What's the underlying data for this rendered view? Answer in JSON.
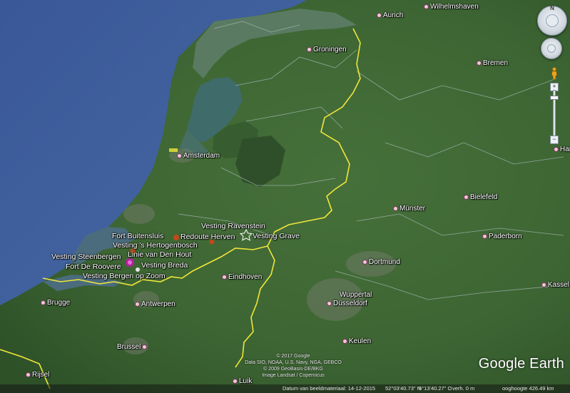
{
  "map": {
    "cities": [
      {
        "id": "aurich",
        "label": "Aurich"
      },
      {
        "id": "wilhelmshaven",
        "label": "Wilhelmshaven"
      },
      {
        "id": "groningen",
        "label": "Groningen"
      },
      {
        "id": "bremen",
        "label": "Bremen"
      },
      {
        "id": "amsterdam",
        "label": "Amsterdam"
      },
      {
        "id": "ham",
        "label": "Ham"
      },
      {
        "id": "bielefeld",
        "label": "Bielefeld"
      },
      {
        "id": "munster",
        "label": "Münster"
      },
      {
        "id": "paderborn",
        "label": "Paderborn"
      },
      {
        "id": "dortmund",
        "label": "Dortmund"
      },
      {
        "id": "eindhoven",
        "label": "Eindhoven"
      },
      {
        "id": "wuppertal",
        "label": "Wuppertal"
      },
      {
        "id": "dusseldorf",
        "label": "Düsseldorf"
      },
      {
        "id": "kassel",
        "label": "Kassel"
      },
      {
        "id": "brugge",
        "label": "Brugge"
      },
      {
        "id": "antwerpen",
        "label": "Antwerpen"
      },
      {
        "id": "keulen",
        "label": "Keulen"
      },
      {
        "id": "brussel",
        "label": "Brussel"
      },
      {
        "id": "rijsel",
        "label": "Rijsel"
      },
      {
        "id": "luik",
        "label": "Luik"
      }
    ],
    "places": [
      {
        "id": "vesting-ravenstein",
        "label": "Vesting Ravenstein"
      },
      {
        "id": "redoute-herven",
        "label": "Redoute Herven"
      },
      {
        "id": "vesting-grave",
        "label": "Vesting Grave"
      },
      {
        "id": "fort-buitensluis",
        "label": "Fort Buitensluis"
      },
      {
        "id": "vesting-hertogenbosch",
        "label": "Vesting 's Hertogenbosch"
      },
      {
        "id": "vesting-steenbergen",
        "label": "Vesting Steenbergen"
      },
      {
        "id": "linie-van-den-hout",
        "label": "Linie van Den Hout"
      },
      {
        "id": "fort-de-roovere",
        "label": "Fort De Roovere"
      },
      {
        "id": "vesting-breda",
        "label": "Vesting Breda"
      },
      {
        "id": "vesting-bergen-op-zoom",
        "label": "Vesting Bergen op Zoom"
      }
    ]
  },
  "attribution": {
    "line1": "© 2017 Google",
    "line2": "Data SIO, NOAA, U.S. Navy, NGA, GEBCO",
    "line3": "© 2009 GeoBasis-DE/BKG",
    "line4": "Image Landsat / Copernicus"
  },
  "logo": "Google Earth",
  "controls": {
    "north": "N",
    "zoom_in": "+",
    "zoom_out": "−",
    "zoom_level": 0.9
  },
  "status": {
    "image_date": "Datum van beeldmateriaal: 14-12-2015",
    "lat": "52°03'40.73\" N",
    "lon": "6°13'40.27\" O",
    "elev": "verh.    0 m",
    "eye_alt": "ooghoogte  426.49 km"
  },
  "colors": {
    "sea": "#3f5f9e",
    "land": "#3f6a35",
    "border": "#f0e63a",
    "admin_border": "#b7c2c8"
  }
}
